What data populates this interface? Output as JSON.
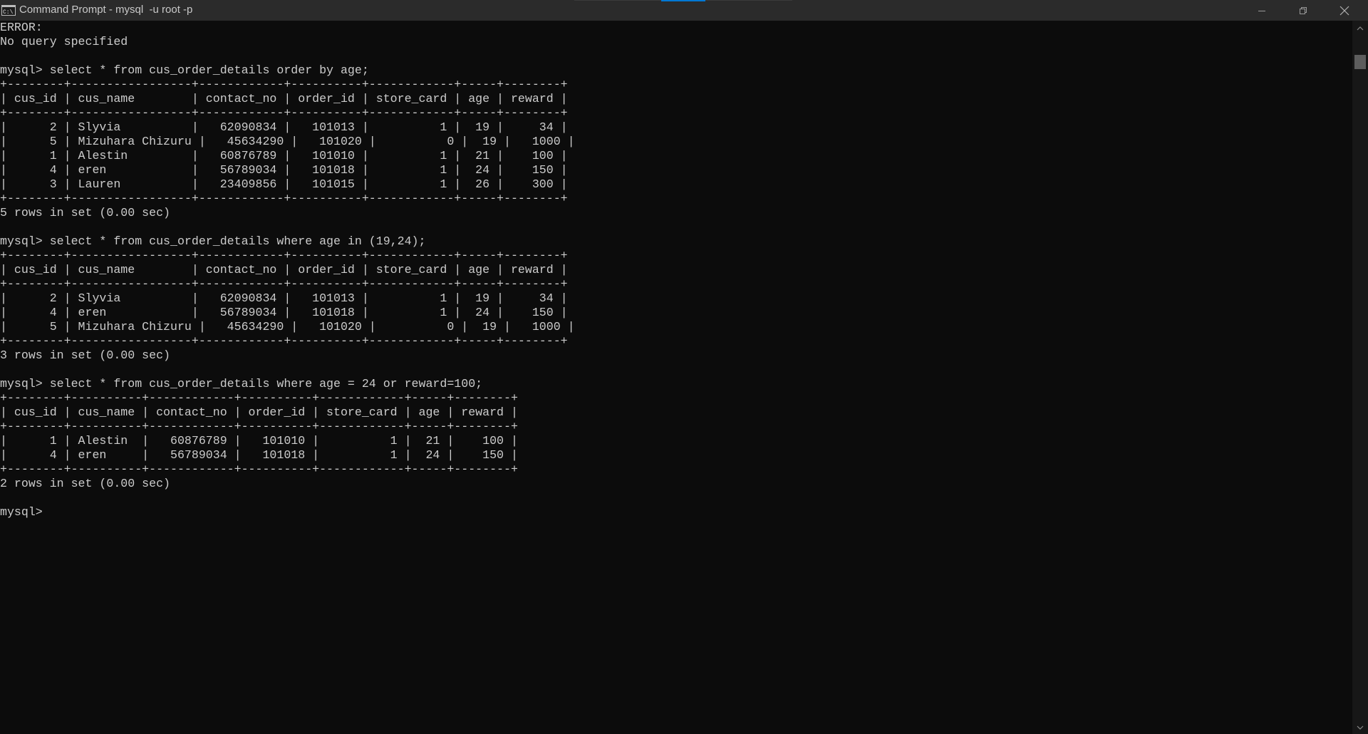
{
  "window": {
    "title": "Command Prompt - mysql  -u root -p",
    "icon": "cmd-icon",
    "controls": [
      "minimize-icon",
      "maximize-icon",
      "close-icon"
    ]
  },
  "console": {
    "lines": [
      "ERROR:",
      "No query specified",
      "",
      "mysql> select * from cus_order_details order by age;",
      "+--------+-----------------+------------+----------+------------+-----+--------+",
      "| cus_id | cus_name        | contact_no | order_id | store_card | age | reward |",
      "+--------+-----------------+------------+----------+------------+-----+--------+",
      "|      2 | Slyvia          |   62090834 |   101013 |          1 |  19 |     34 |",
      "|      5 | Mizuhara Chizuru |   45634290 |   101020 |          0 |  19 |   1000 |",
      "|      1 | Alestin         |   60876789 |   101010 |          1 |  21 |    100 |",
      "|      4 | eren            |   56789034 |   101018 |          1 |  24 |    150 |",
      "|      3 | Lauren          |   23409856 |   101015 |          1 |  26 |    300 |",
      "+--------+-----------------+------------+----------+------------+-----+--------+",
      "5 rows in set (0.00 sec)",
      "",
      "mysql> select * from cus_order_details where age in (19,24);",
      "+--------+-----------------+------------+----------+------------+-----+--------+",
      "| cus_id | cus_name        | contact_no | order_id | store_card | age | reward |",
      "+--------+-----------------+------------+----------+------------+-----+--------+",
      "|      2 | Slyvia          |   62090834 |   101013 |          1 |  19 |     34 |",
      "|      4 | eren            |   56789034 |   101018 |          1 |  24 |    150 |",
      "|      5 | Mizuhara Chizuru |   45634290 |   101020 |          0 |  19 |   1000 |",
      "+--------+-----------------+------------+----------+------------+-----+--------+",
      "3 rows in set (0.00 sec)",
      "",
      "mysql> select * from cus_order_details where age = 24 or reward=100;",
      "+--------+----------+------------+----------+------------+-----+--------+",
      "| cus_id | cus_name | contact_no | order_id | store_card | age | reward |",
      "+--------+----------+------------+----------+------------+-----+--------+",
      "|      1 | Alestin  |   60876789 |   101010 |          1 |  21 |    100 |",
      "|      4 | eren     |   56789034 |   101018 |          1 |  24 |    150 |",
      "+--------+----------+------------+----------+------------+-----+--------+",
      "2 rows in set (0.00 sec)",
      "",
      "mysql> "
    ]
  },
  "colors": {
    "background": "#0c0c0c",
    "foreground": "#cccccc",
    "titlebar": "#2b2b2b",
    "scrollbar_thumb": "#5d5d5d"
  }
}
